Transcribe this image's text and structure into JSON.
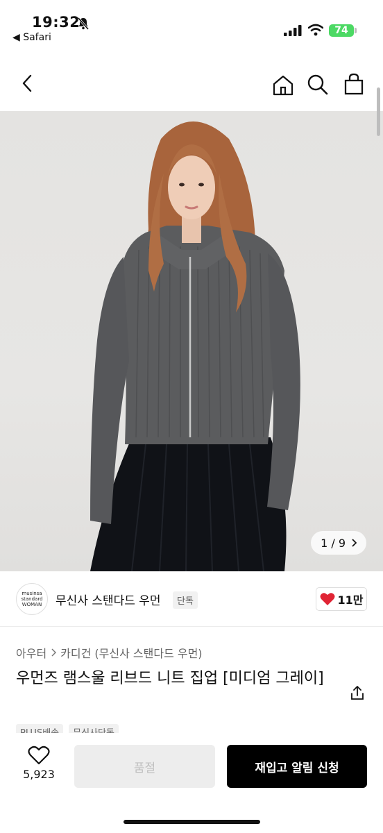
{
  "status_bar": {
    "time": "19:32",
    "back_app": "◀ Safari",
    "battery": "74"
  },
  "nav": {
    "icons": [
      "back-icon",
      "home-icon",
      "search-icon",
      "cart-icon"
    ]
  },
  "gallery": {
    "current": "1",
    "total": "9",
    "counter": "1 / 9"
  },
  "brand": {
    "logo_lines": [
      "musinsa",
      "standard",
      "WOMAN"
    ],
    "name": "무신사 스탠다드 우먼",
    "exclusive_tag": "단독",
    "likes": "11만"
  },
  "product": {
    "breadcrumb": [
      "아우터",
      "카디건 (무신사 스탠다드 우먼)"
    ],
    "title": "우먼즈 램스울 리브드 니트 집업 [미디엄 그레이]",
    "tags": [
      "PLUS배송",
      "무신사단독"
    ]
  },
  "bottom_bar": {
    "wish_count": "5,923",
    "soldout_label": "품절",
    "restock_label": "재입고 알림 신청"
  },
  "colors": {
    "heart": "#e02434",
    "battery": "#4cd964",
    "primary_button": "#000000"
  }
}
